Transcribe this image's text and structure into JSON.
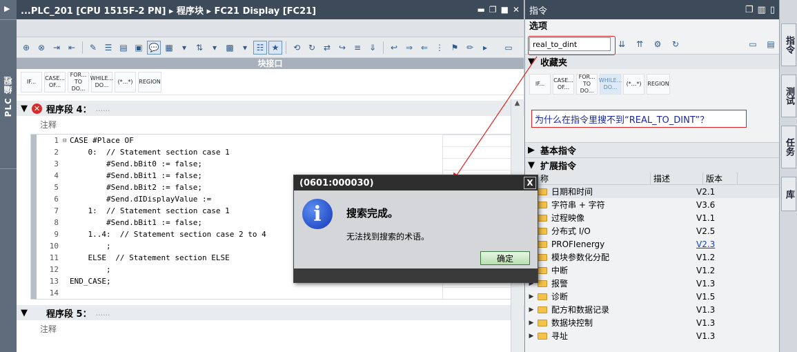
{
  "left_strip": {
    "label": "PLC 编程",
    "arrow": "▶"
  },
  "editor": {
    "title": "...PLC_201 [CPU 1515F-2 PN]  ▸ 程序块  ▸ FC21 Display [FC21]",
    "block_interface": "块接口",
    "snippets": [
      "IF...",
      "CASE... OF...",
      "FOR... TO DO...",
      "WHILE... DO...",
      "(*...*)",
      "REGION"
    ],
    "network4": {
      "label": "程序段 4：",
      "dots": "......",
      "comment": "注释"
    },
    "network5": {
      "label": "程序段 5：",
      "dots": "......",
      "comment": "注释"
    },
    "code_lines": [
      {
        "n": "1",
        "fold": "⊟",
        "text": "CASE #Place OF"
      },
      {
        "n": "2",
        "fold": "",
        "text": "    0:  // Statement section case 1"
      },
      {
        "n": "3",
        "fold": "",
        "text": "        #Send.bBit0 := false;"
      },
      {
        "n": "4",
        "fold": "",
        "text": "        #Send.bBit1 := false;"
      },
      {
        "n": "5",
        "fold": "",
        "text": "        #Send.bBit2 := false;"
      },
      {
        "n": "6",
        "fold": "",
        "text": "        #Send.dIDisplayValue :="
      },
      {
        "n": "7",
        "fold": "",
        "text": "    1:  // Statement section case 1"
      },
      {
        "n": "8",
        "fold": "",
        "text": "        #Send.bBit1 := false;"
      },
      {
        "n": "9",
        "fold": "",
        "text": "    1..4:  // Statement section case 2 to 4"
      },
      {
        "n": "10",
        "fold": "",
        "text": "        ;"
      },
      {
        "n": "11",
        "fold": "",
        "text": "    ELSE  // Statement section ELSE"
      },
      {
        "n": "12",
        "fold": "",
        "text": "        ;"
      },
      {
        "n": "13",
        "fold": "",
        "text": "END_CASE;"
      },
      {
        "n": "14",
        "fold": "",
        "text": ""
      }
    ]
  },
  "instructions": {
    "title": "指令",
    "options_label": "选项",
    "search_value": "real_to_dint",
    "favorites_label": "收藏夹",
    "snippets": [
      "IF...",
      "CASE... OF...",
      "FOR... TO DO...",
      "WHILE... DO...",
      "(*...*)",
      "REGION"
    ],
    "question": "为什么在指令里搜不到“REAL_TO_DINT”？",
    "basic_label": "基本指令",
    "extended_label": "扩展指令",
    "columns": [
      "称",
      "描述",
      "版本"
    ],
    "rows": [
      {
        "name": "日期和时间",
        "desc": "",
        "ver": "V2.1"
      },
      {
        "name": "字符串 + 字符",
        "desc": "",
        "ver": "V3.6"
      },
      {
        "name": "过程映像",
        "desc": "",
        "ver": "V1.1"
      },
      {
        "name": "分布式 I/O",
        "desc": "",
        "ver": "V2.5"
      },
      {
        "name": "PROFIenergy",
        "desc": "",
        "ver": "V2.3"
      },
      {
        "name": "模块参数化分配",
        "desc": "",
        "ver": "V1.2"
      },
      {
        "name": "中断",
        "desc": "",
        "ver": "V1.2"
      },
      {
        "name": "报警",
        "desc": "",
        "ver": "V1.3"
      },
      {
        "name": "诊断",
        "desc": "",
        "ver": "V1.5"
      },
      {
        "name": "配方和数据记录",
        "desc": "",
        "ver": "V1.3"
      },
      {
        "name": "数据块控制",
        "desc": "",
        "ver": "V1.3"
      },
      {
        "name": "寻址",
        "desc": "",
        "ver": "V1.3"
      }
    ]
  },
  "right_tabs": [
    "指令",
    "测试",
    "任务",
    "库"
  ],
  "dialog": {
    "title": "(0601:000030)",
    "close": "X",
    "message": "搜索完成。",
    "detail": "无法找到搜索的术语。",
    "ok_label": "确定"
  },
  "colors": {
    "title_bar": "#3d4a59",
    "highlight_red": "#e02020",
    "question_text": "#1a28a8"
  }
}
